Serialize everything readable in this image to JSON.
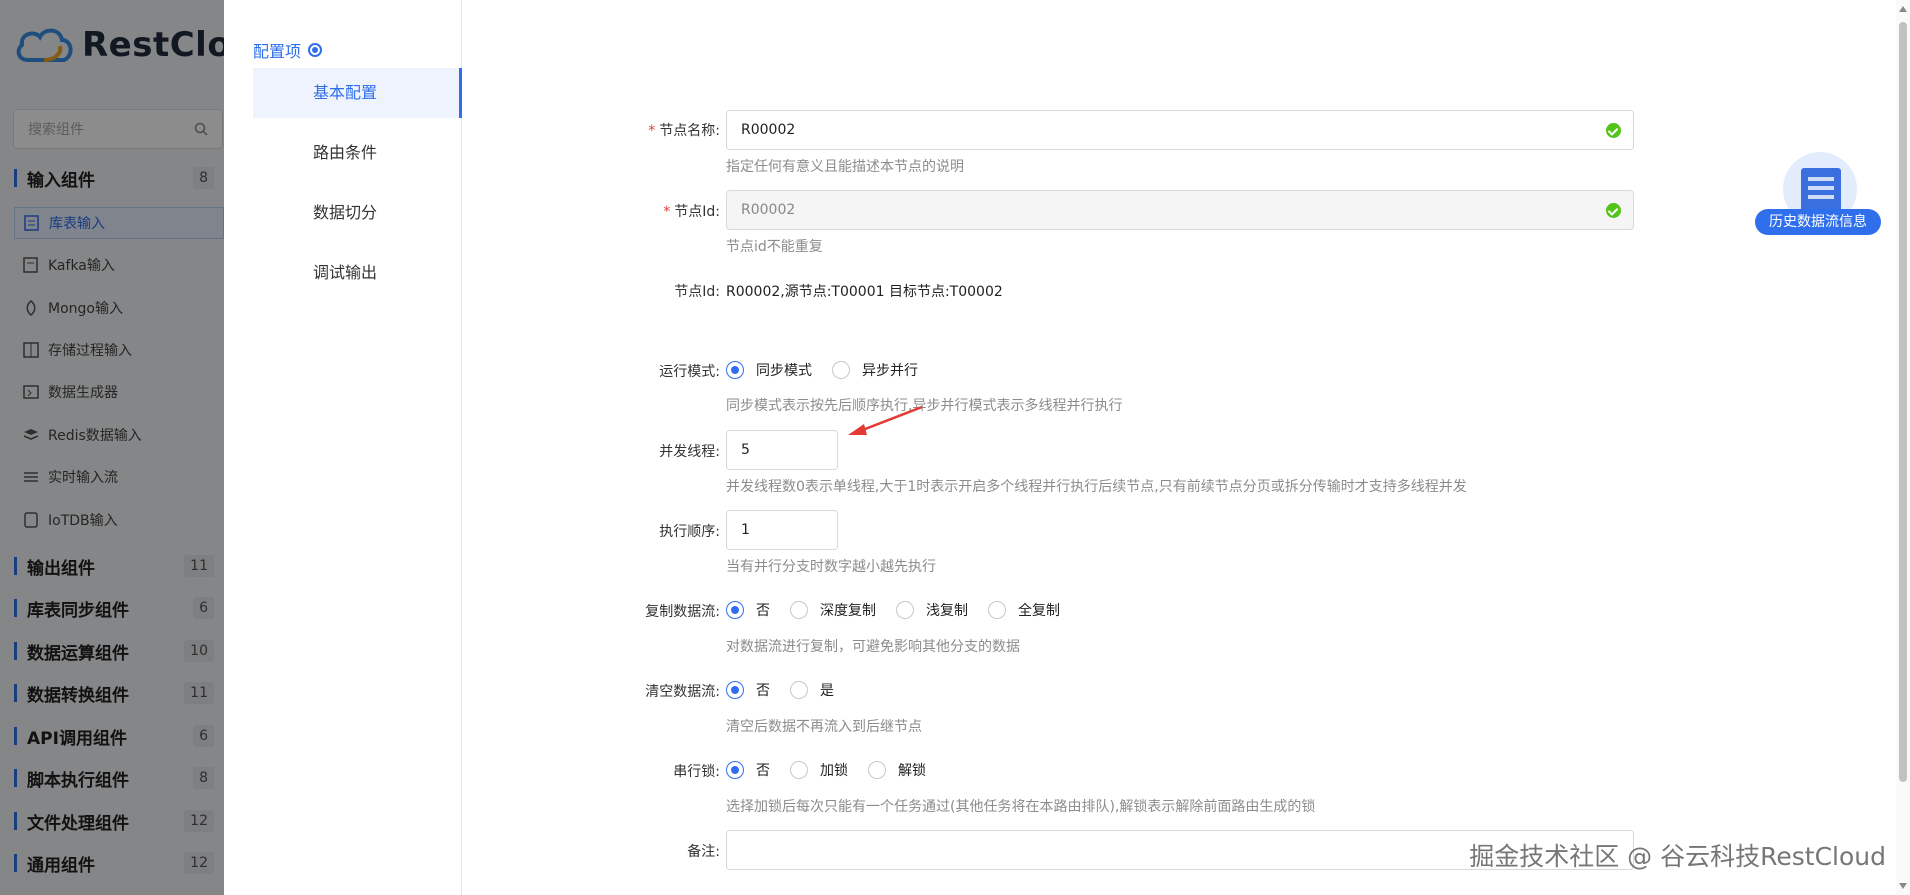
{
  "app": {
    "logo_text": "RestCloud"
  },
  "sidebar": {
    "search_placeholder": "搜索组件",
    "categories": [
      {
        "label": "输入组件",
        "count": "8"
      },
      {
        "label": "输出组件",
        "count": "11"
      },
      {
        "label": "库表同步组件",
        "count": "6"
      },
      {
        "label": "数据运算组件",
        "count": "10"
      },
      {
        "label": "数据转换组件",
        "count": "11"
      },
      {
        "label": "API调用组件",
        "count": "6"
      },
      {
        "label": "脚本执行组件",
        "count": "8"
      },
      {
        "label": "文件处理组件",
        "count": "12"
      },
      {
        "label": "通用组件",
        "count": "12"
      }
    ],
    "input_components": [
      {
        "label": "库表输入",
        "icon": "table-input-icon"
      },
      {
        "label": "Kafka输入",
        "icon": "kafka-icon"
      },
      {
        "label": "Mongo输入",
        "icon": "mongo-icon"
      },
      {
        "label": "存储过程输入",
        "icon": "procedure-icon"
      },
      {
        "label": "数据生成器",
        "icon": "generator-icon"
      },
      {
        "label": "Redis数据输入",
        "icon": "redis-icon"
      },
      {
        "label": "实时输入流",
        "icon": "stream-icon"
      },
      {
        "label": "IoTDB输入",
        "icon": "iotdb-icon"
      }
    ]
  },
  "drawer": {
    "nav_title": "配置项",
    "nav_items": [
      "基本配置",
      "路由条件",
      "数据切分",
      "调试输出"
    ],
    "form": {
      "node_name": {
        "label": "节点名称:",
        "value": "R00002",
        "help": "指定任何有意义且能描述本节点的说明"
      },
      "node_id": {
        "label": "节点Id:",
        "value": "R00002",
        "help": "节点id不能重复"
      },
      "node_info": {
        "label": "节点Id:",
        "value": "R00002,源节点:T00001 目标节点:T00002"
      },
      "run_mode": {
        "label": "运行模式:",
        "options": [
          "同步模式",
          "异步并行"
        ],
        "selected": "同步模式",
        "help": "同步模式表示按先后顺序执行,异步并行模式表示多线程并行执行"
      },
      "threads": {
        "label": "并发线程:",
        "value": "5",
        "help": "并发线程数0表示单线程,大于1时表示开启多个线程并行执行后续节点,只有前续节点分页或拆分传输时才支持多线程并发"
      },
      "exec_order": {
        "label": "执行顺序:",
        "value": "1",
        "help": "当有并行分支时数字越小越先执行"
      },
      "copy_stream": {
        "label": "复制数据流:",
        "options": [
          "否",
          "深度复制",
          "浅复制",
          "全复制"
        ],
        "selected": "否",
        "help": "对数据流进行复制，可避免影响其他分支的数据"
      },
      "clear_stream": {
        "label": "清空数据流:",
        "options": [
          "否",
          "是"
        ],
        "selected": "否",
        "help": "清空后数据不再流入到后继节点"
      },
      "serial_lock": {
        "label": "串行锁:",
        "options": [
          "否",
          "加锁",
          "解锁"
        ],
        "selected": "否",
        "help": "选择加锁后每次只能有一个任务通过(其他任务将在本路由排队),解锁表示解除前面路由生成的锁"
      },
      "remark": {
        "label": "备注:",
        "value": ""
      }
    }
  },
  "history_button": {
    "label": "历史数据流信息"
  },
  "watermark": "掘金技术社区 @ 谷云科技RestCloud",
  "colors": {
    "primary": "#2f6fec",
    "success": "#52c41a",
    "required": "#e53935",
    "arrow": "#e53935"
  }
}
